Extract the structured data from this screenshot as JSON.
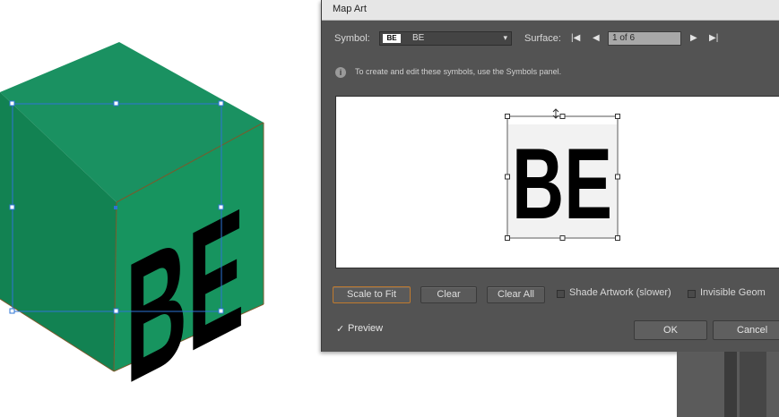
{
  "canvas": {
    "artwork_text": "BE",
    "colors": {
      "top": "#1a9161",
      "left": "#128252",
      "right": "#17945f",
      "edge": "#7a5a2c",
      "selection": "#2d74d6"
    }
  },
  "dialog": {
    "title": "Map Art",
    "symbol": {
      "label": "Symbol:",
      "thumb_text": "BE",
      "value": "BE"
    },
    "surface": {
      "label": "Surface:",
      "value": "1 of 6",
      "first_icon": "first-surface-icon",
      "prev_icon": "prev-surface-icon",
      "next_icon": "next-surface-icon",
      "last_icon": "last-surface-icon"
    },
    "info": {
      "icon": "info-icon",
      "text": "To create and edit these symbols, use the Symbols panel."
    },
    "preview_art_text": "BE",
    "buttons": {
      "scale_to_fit": "Scale to Fit",
      "clear": "Clear",
      "clear_all": "Clear All",
      "ok": "OK",
      "cancel": "Cancel"
    },
    "options": {
      "shade_artwork": {
        "label": "Shade Artwork (slower)",
        "checked": false
      },
      "invisible_geometry": {
        "label": "Invisible Geom",
        "checked": false
      },
      "preview": {
        "label": "Preview",
        "checked": true
      }
    }
  }
}
